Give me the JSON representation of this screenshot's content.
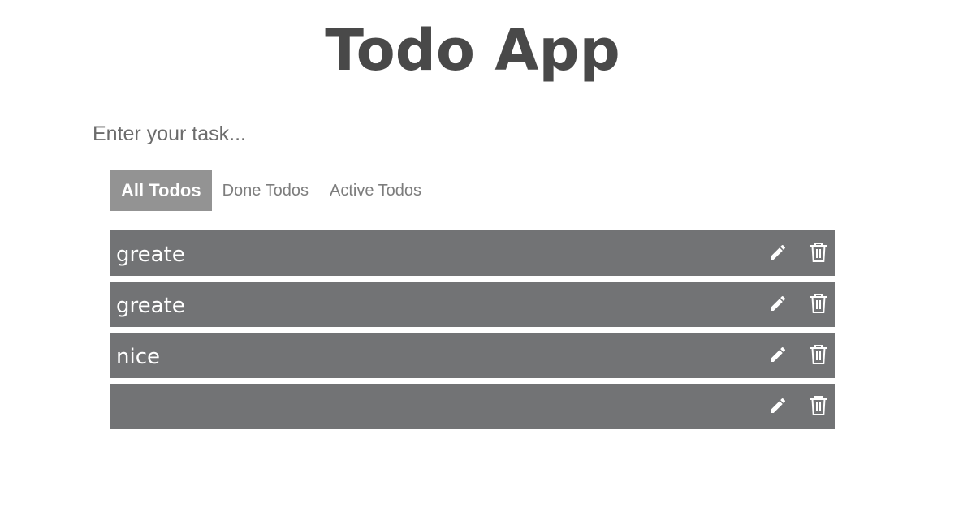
{
  "app": {
    "title": "Todo App"
  },
  "input": {
    "placeholder": "Enter your task...",
    "value": ""
  },
  "tabs": [
    {
      "label": "All Todos",
      "active": true
    },
    {
      "label": "Done Todos",
      "active": false
    },
    {
      "label": "Active Todos",
      "active": false
    }
  ],
  "todos": [
    {
      "text": "greate",
      "actions": [
        "pencil-icon",
        "trash-icon"
      ]
    },
    {
      "text": "greate",
      "actions": [
        "pencil-icon",
        "trash-icon"
      ]
    },
    {
      "text": "nice",
      "actions": [
        "pencil-icon",
        "trash-icon"
      ]
    },
    {
      "text": "",
      "actions": [
        "pencil-icon",
        "trash-icon"
      ]
    }
  ],
  "colors": {
    "title": "#494949",
    "active_tab_bg": "#939393",
    "todo_bg": "#727375",
    "inactive_tab_text": "#7d7d7d"
  }
}
